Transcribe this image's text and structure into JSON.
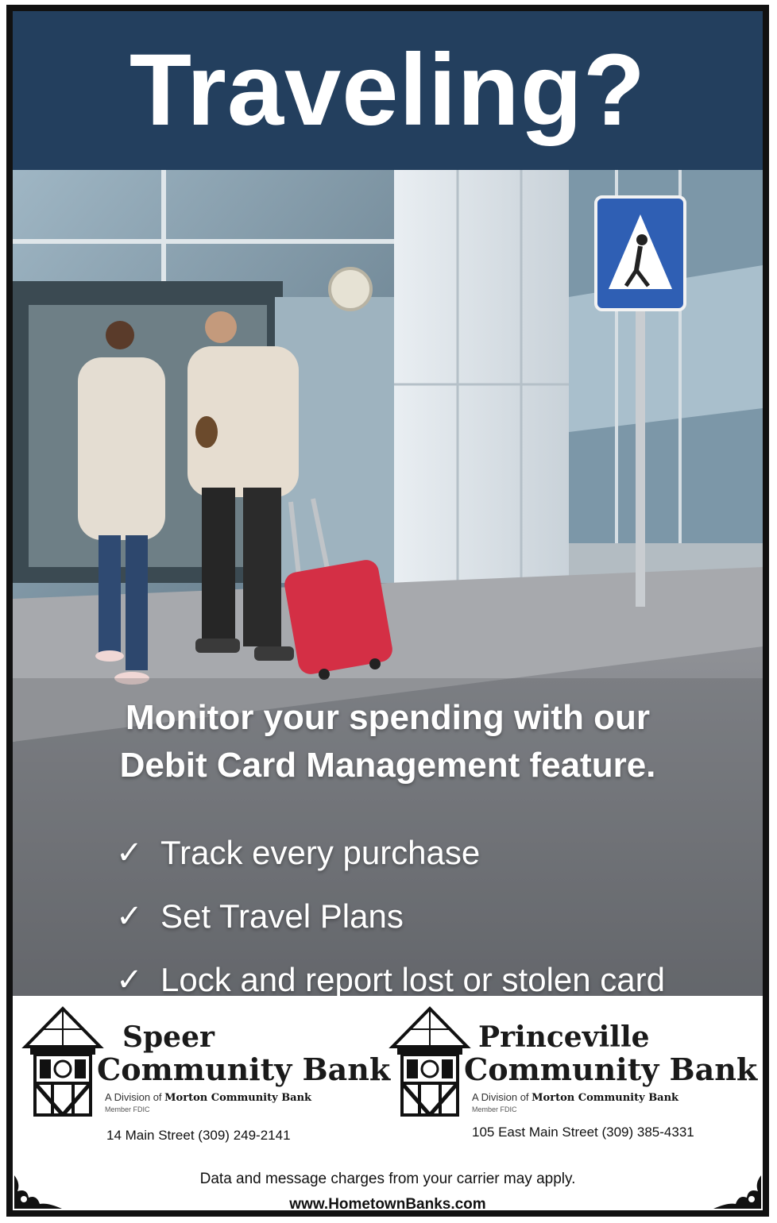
{
  "header": {
    "headline": "Traveling?"
  },
  "promo": {
    "line1": "Monitor your spending with our",
    "line2": "Debit Card Management feature."
  },
  "features": [
    {
      "check": "✓",
      "text": "Track every purchase"
    },
    {
      "check": "✓",
      "text": "Set Travel Plans"
    },
    {
      "check": "✓",
      "text": "Lock and report lost or stolen card"
    }
  ],
  "banks": [
    {
      "name_line1": "Speer",
      "name_line2": "Community Bank",
      "division_prefix": "A Division of",
      "division_name": "Morton Community Bank",
      "member": "Member FDIC",
      "address": "14 Main Street (309) 249-2141"
    },
    {
      "name_line1": "Princeville",
      "name_line2": "Community Bank",
      "division_prefix": "A Division of",
      "division_name": "Morton Community Bank",
      "member": "Member FDIC",
      "address": "105 East Main Street  (309) 385-4331"
    }
  ],
  "footer": {
    "disclaimer": "Data and message charges from your carrier may apply.",
    "website": "www.HometownBanks.com"
  },
  "colors": {
    "header_bg": "#233f5e",
    "luggage": "#d42f45",
    "sign_blue": "#2f5fb4"
  },
  "icons": [
    "pedestrian-crossing-sign-icon",
    "clock-tower-logo-icon",
    "ornament-corner-icon",
    "check-icon"
  ]
}
